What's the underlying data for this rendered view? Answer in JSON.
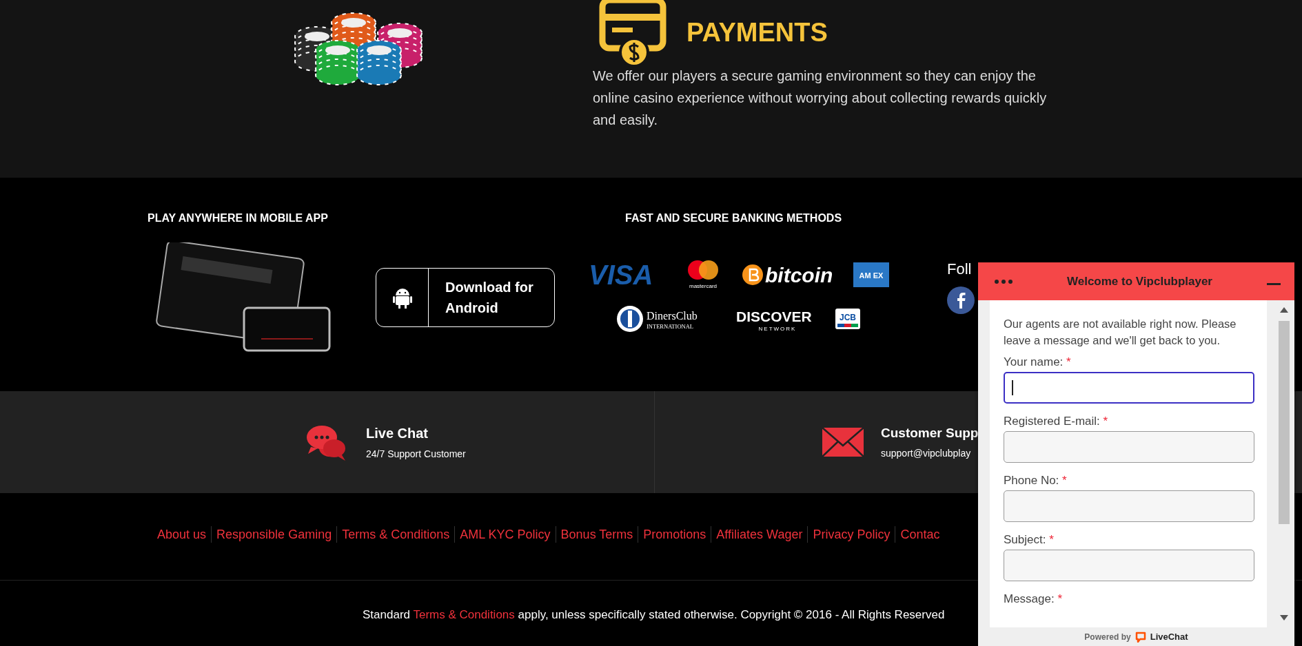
{
  "feature": {
    "heading_lines": [
      "PAYMENTS"
    ],
    "text": "We offer our players a secure gaming environment so they can enjoy the online casino experience without worrying about collecting rewards quickly and easily."
  },
  "app": {
    "heading": "PLAY ANYWHERE IN MOBILE APP",
    "button": "Download for Android"
  },
  "banking": {
    "heading": "FAST AND SECURE BANKING METHODS",
    "logos": [
      {
        "kind": "visa",
        "text": "VISA"
      },
      {
        "kind": "mastercard",
        "text": "mastercard"
      },
      {
        "kind": "bitcoin",
        "text": "bitcoin"
      },
      {
        "kind": "amex",
        "text": "AM EX"
      },
      {
        "kind": "diners",
        "text": "DinersClub",
        "sub": "INTERNATIONAL"
      },
      {
        "kind": "discover",
        "text": "DISCOVER",
        "sub": "NETWORK"
      },
      {
        "kind": "jcb",
        "text": "JCB"
      }
    ]
  },
  "follow": {
    "label": "Foll"
  },
  "support": [
    {
      "kind": "chat",
      "title": "Live Chat",
      "text": "24/7 Support Customer"
    },
    {
      "kind": "mail",
      "title": "Customer Supp",
      "text": "support@vipclubplay"
    }
  ],
  "links": [
    "About us",
    "Responsible Gaming",
    "Terms & Conditions",
    "AML KYC Policy",
    "Bonus Terms",
    "Promotions",
    "Affiliates Wager",
    "Privacy Policy",
    "Contac"
  ],
  "copyright": {
    "before": "Standard ",
    "link": "Terms & Conditions",
    "after": " apply, unless specifically stated otherwise. Copyright © 2016 - All Rights Reserved"
  },
  "chat": {
    "title": "Welcome to Vipclubplayer",
    "notice": "Our agents are not available right now. Please leave a message and we'll get back to you.",
    "fields": [
      {
        "kind": "input",
        "label": "Your name:",
        "mark": "*",
        "focused": true
      },
      {
        "kind": "input",
        "label": "Registered E-mail:",
        "mark": "*",
        "focused": false
      },
      {
        "kind": "input",
        "label": "Phone No:",
        "mark": "*",
        "focused": false
      },
      {
        "kind": "input",
        "label": "Subject:",
        "mark": "*",
        "focused": false
      },
      {
        "kind": "label",
        "label": "Message:",
        "mark": "*"
      }
    ],
    "powered_by": "Powered by",
    "brand": "LiveChat"
  }
}
